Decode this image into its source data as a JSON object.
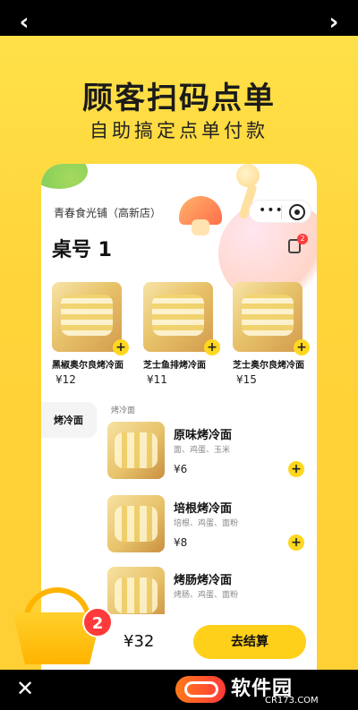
{
  "hero": {
    "title": "顾客扫码点单",
    "subtitle": "自助搞定点单付款"
  },
  "mini_app": {
    "store_name": "青春食光铺（高新店）",
    "table_label": "桌号 1",
    "order_badge": "2",
    "capsule": {
      "menu_icon": "more-icon",
      "target_icon": "target-icon"
    },
    "featured": [
      {
        "name": "黑椒奥尔良烤冷面",
        "price": "¥12"
      },
      {
        "name": "芝士鱼排烤冷面",
        "price": "¥11"
      },
      {
        "name": "芝士奥尔良烤冷面",
        "price": "¥15"
      }
    ],
    "sidebar": {
      "active": "烤冷面"
    },
    "section": {
      "title": "烤冷面",
      "items": [
        {
          "title": "原味烤冷面",
          "desc": "面、鸡蛋、玉米",
          "price": "¥6"
        },
        {
          "title": "培根烤冷面",
          "desc": "培根、鸡蛋、面粉",
          "price": "¥8"
        },
        {
          "title": "烤肠烤冷面",
          "desc": "烤肠、鸡蛋、面粉",
          "price": ""
        }
      ]
    },
    "cart": {
      "count": "2",
      "total": "¥32",
      "checkout_label": "去结算"
    }
  },
  "frame": {
    "watermark_text": "软件园",
    "watermark_sub": "CR173.COM",
    "nav_left_icon": "back-arrow-icon",
    "nav_right_icon": "forward-arrow-icon",
    "close_icon": "close-icon"
  },
  "colors": {
    "background": "#ffd43a",
    "accent": "#ffd01a",
    "badge": "#ff3a3a"
  }
}
